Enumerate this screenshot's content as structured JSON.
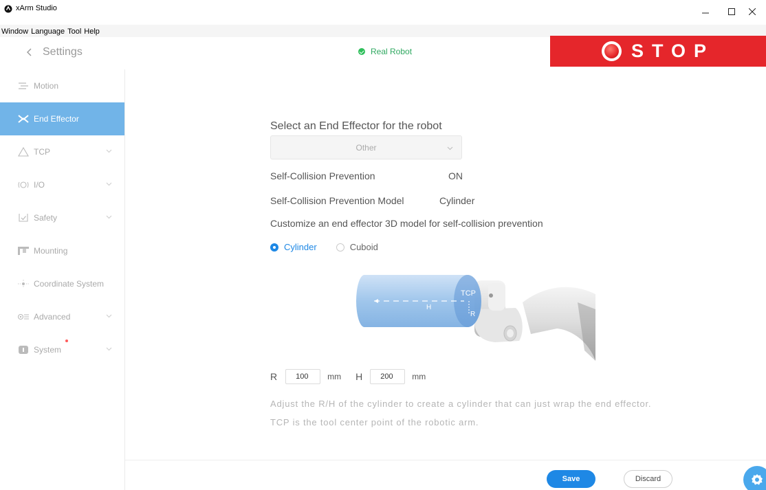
{
  "app": {
    "title": "xArm Studio",
    "icon": "xarm-logo-icon"
  },
  "window_controls": {
    "minimize": "–",
    "maximize": "☐",
    "close": "×"
  },
  "menu": [
    "Window",
    "Language",
    "Tool",
    "Help"
  ],
  "header": {
    "back_label": "Settings",
    "status_label": "Real Robot",
    "status_color": "#2fbf5b",
    "stop_label": "STOP",
    "stop_color": "#e5262b"
  },
  "sidebar": {
    "items": [
      {
        "label": "Motion",
        "icon": "motion-icon",
        "has_chevron": false,
        "active": false
      },
      {
        "label": "End Effector",
        "icon": "end-effector-icon",
        "has_chevron": false,
        "active": true
      },
      {
        "label": "TCP",
        "icon": "tcp-icon",
        "has_chevron": true,
        "active": false
      },
      {
        "label": "I/O",
        "icon": "io-icon",
        "has_chevron": true,
        "active": false
      },
      {
        "label": "Safety",
        "icon": "safety-icon",
        "has_chevron": true,
        "active": false
      },
      {
        "label": "Mounting",
        "icon": "mounting-icon",
        "has_chevron": false,
        "active": false
      },
      {
        "label": "Coordinate System",
        "icon": "coordinate-system-icon",
        "has_chevron": false,
        "active": false
      },
      {
        "label": "Advanced",
        "icon": "advanced-icon",
        "has_chevron": true,
        "active": false
      },
      {
        "label": "System",
        "icon": "system-icon",
        "has_chevron": true,
        "active": false,
        "notification": true
      }
    ],
    "active_color": "#71b4e8"
  },
  "main": {
    "title": "Select an End Effector for the robot",
    "effector_select": {
      "value": "Other"
    },
    "self_collision": {
      "label": "Self-Collision Prevention",
      "value": "ON"
    },
    "self_collision_model": {
      "label": "Self-Collision Prevention Model",
      "value": "Cylinder"
    },
    "customize_label": "Customize an end effector 3D model for self-collision prevention",
    "shape_options": [
      {
        "label": "Cylinder",
        "selected": true
      },
      {
        "label": "Cuboid",
        "selected": false
      }
    ],
    "illustration": {
      "tcp_label": "TCP",
      "h_label": "H",
      "r_label": "R"
    },
    "dimensions": {
      "r_label": "R",
      "r_value": "100",
      "h_label": "H",
      "h_value": "200",
      "unit": "mm"
    },
    "hint": "Adjust the R/H of the cylinder to create a cylinder that can just wrap the end effector. TCP is the tool center point of the robotic arm."
  },
  "footer": {
    "save_label": "Save",
    "discard_label": "Discard",
    "accent_color": "#1e88e5"
  }
}
